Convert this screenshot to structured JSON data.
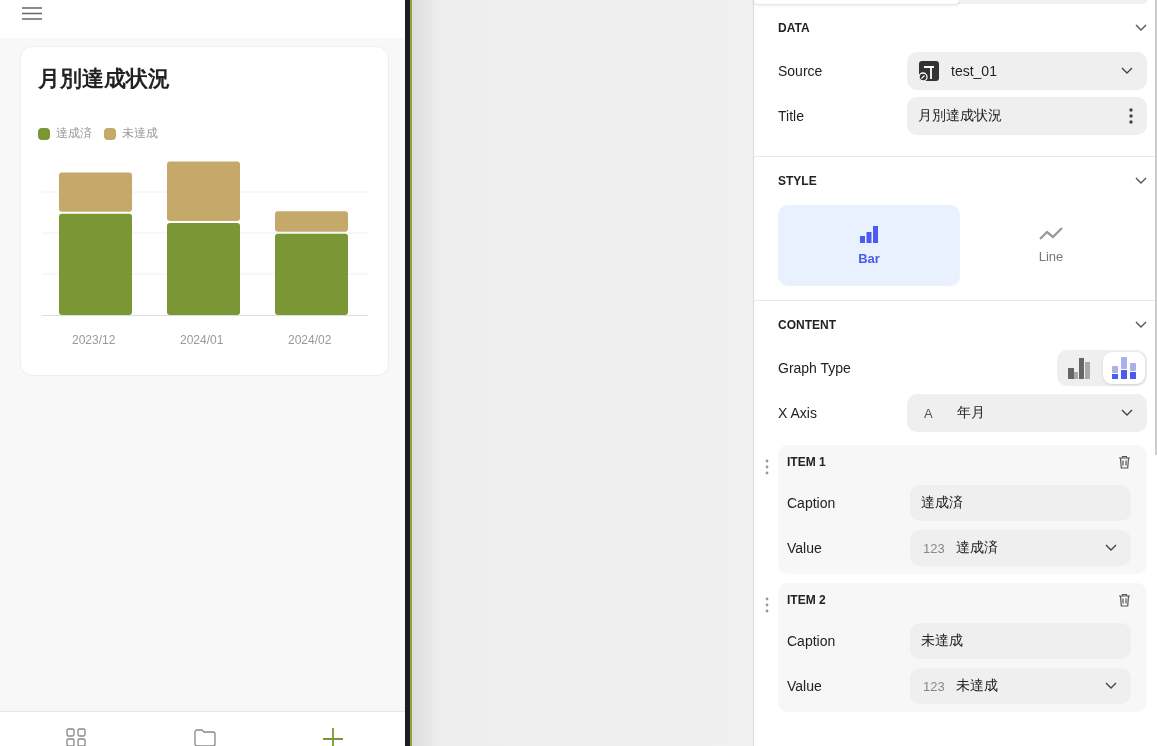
{
  "phone": {
    "card": {
      "title": "月別達成状況",
      "legend": [
        {
          "label": "達成済",
          "color": "#7a9635"
        },
        {
          "label": "未達成",
          "color": "#c4a96b"
        }
      ],
      "categories": [
        "2023/12",
        "2024/01",
        "2024/02"
      ]
    }
  },
  "panel": {
    "data": {
      "title": "DATA",
      "source_label": "Source",
      "source_value": "test_01",
      "title_label": "Title",
      "title_value": "月別達成状況"
    },
    "style": {
      "title": "STYLE",
      "options": [
        {
          "kind": "bar",
          "label": "Bar",
          "selected": true
        },
        {
          "kind": "line",
          "label": "Line",
          "selected": false
        }
      ]
    },
    "content": {
      "title": "CONTENT",
      "graph_type_label": "Graph Type",
      "graph_types": [
        {
          "kind": "grouped",
          "selected": false
        },
        {
          "kind": "stacked",
          "selected": true
        }
      ],
      "x_axis_label": "X Axis",
      "x_axis_type": "A",
      "x_axis_value": "年月",
      "items": [
        {
          "heading": "ITEM 1",
          "caption_label": "Caption",
          "caption_value": "達成済",
          "value_label": "Value",
          "value_type": "123",
          "value": "達成済"
        },
        {
          "heading": "ITEM 2",
          "caption_label": "Caption",
          "caption_value": "未達成",
          "value_label": "Value",
          "value_type": "123",
          "value": "未達成"
        }
      ]
    }
  }
}
